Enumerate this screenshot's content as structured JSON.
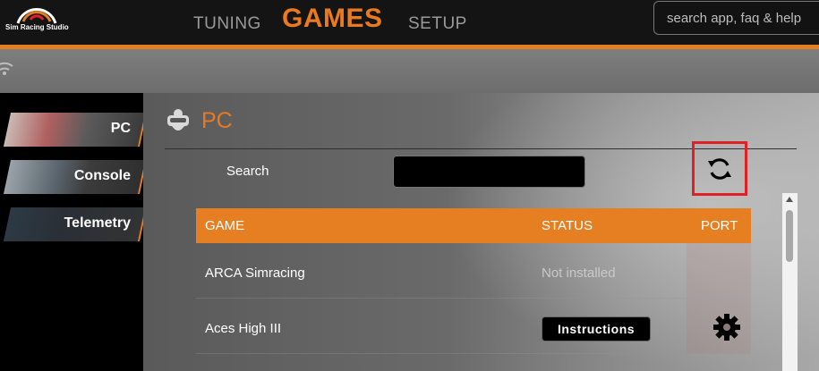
{
  "header": {
    "logo_text": "Sim Racing Studio",
    "nav": {
      "tuning": "TUNING",
      "games": "GAMES",
      "setup": "SETUP"
    },
    "search_placeholder": "search app, faq & help"
  },
  "sidebar": {
    "items": [
      {
        "label": "PC"
      },
      {
        "label": "Console"
      },
      {
        "label": "Telemetry"
      }
    ]
  },
  "main": {
    "title": "PC",
    "search_label": "Search",
    "search_value": "",
    "table": {
      "headers": {
        "game": "GAME",
        "status": "STATUS",
        "port": "PORT"
      },
      "rows": [
        {
          "game": "ARCA Simracing",
          "status": "Not installed"
        },
        {
          "game": "Aces High III",
          "button": "Instructions"
        }
      ]
    }
  },
  "colors": {
    "accent": "#e67e22",
    "highlight": "#e01f26"
  },
  "icons": {
    "refresh": "refresh-icon",
    "settings": "gear-icon",
    "wifi": "wifi-icon",
    "vr": "vr-headset-icon"
  }
}
